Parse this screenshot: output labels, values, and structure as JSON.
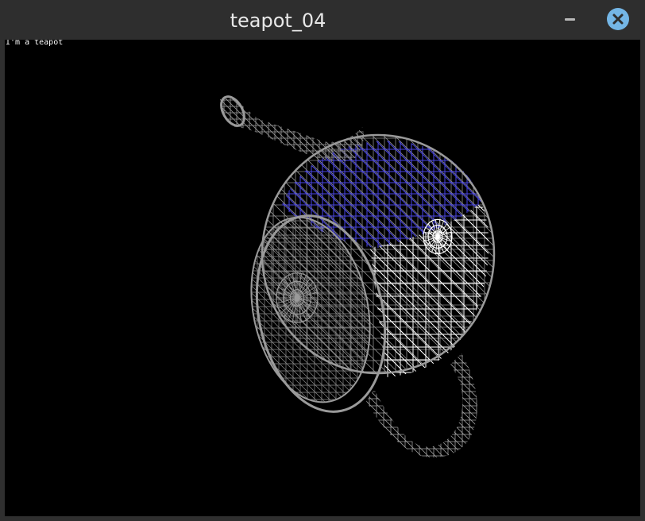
{
  "window": {
    "title": "teapot_04"
  },
  "viewport": {
    "overlay_text": "I'm a teapot",
    "wire_color": "#9a9a9a",
    "highlight_color": "#ffffff",
    "selected_color": "#4a46e6"
  },
  "icons": {
    "minimize": "minimize-icon",
    "close": "close-icon"
  }
}
